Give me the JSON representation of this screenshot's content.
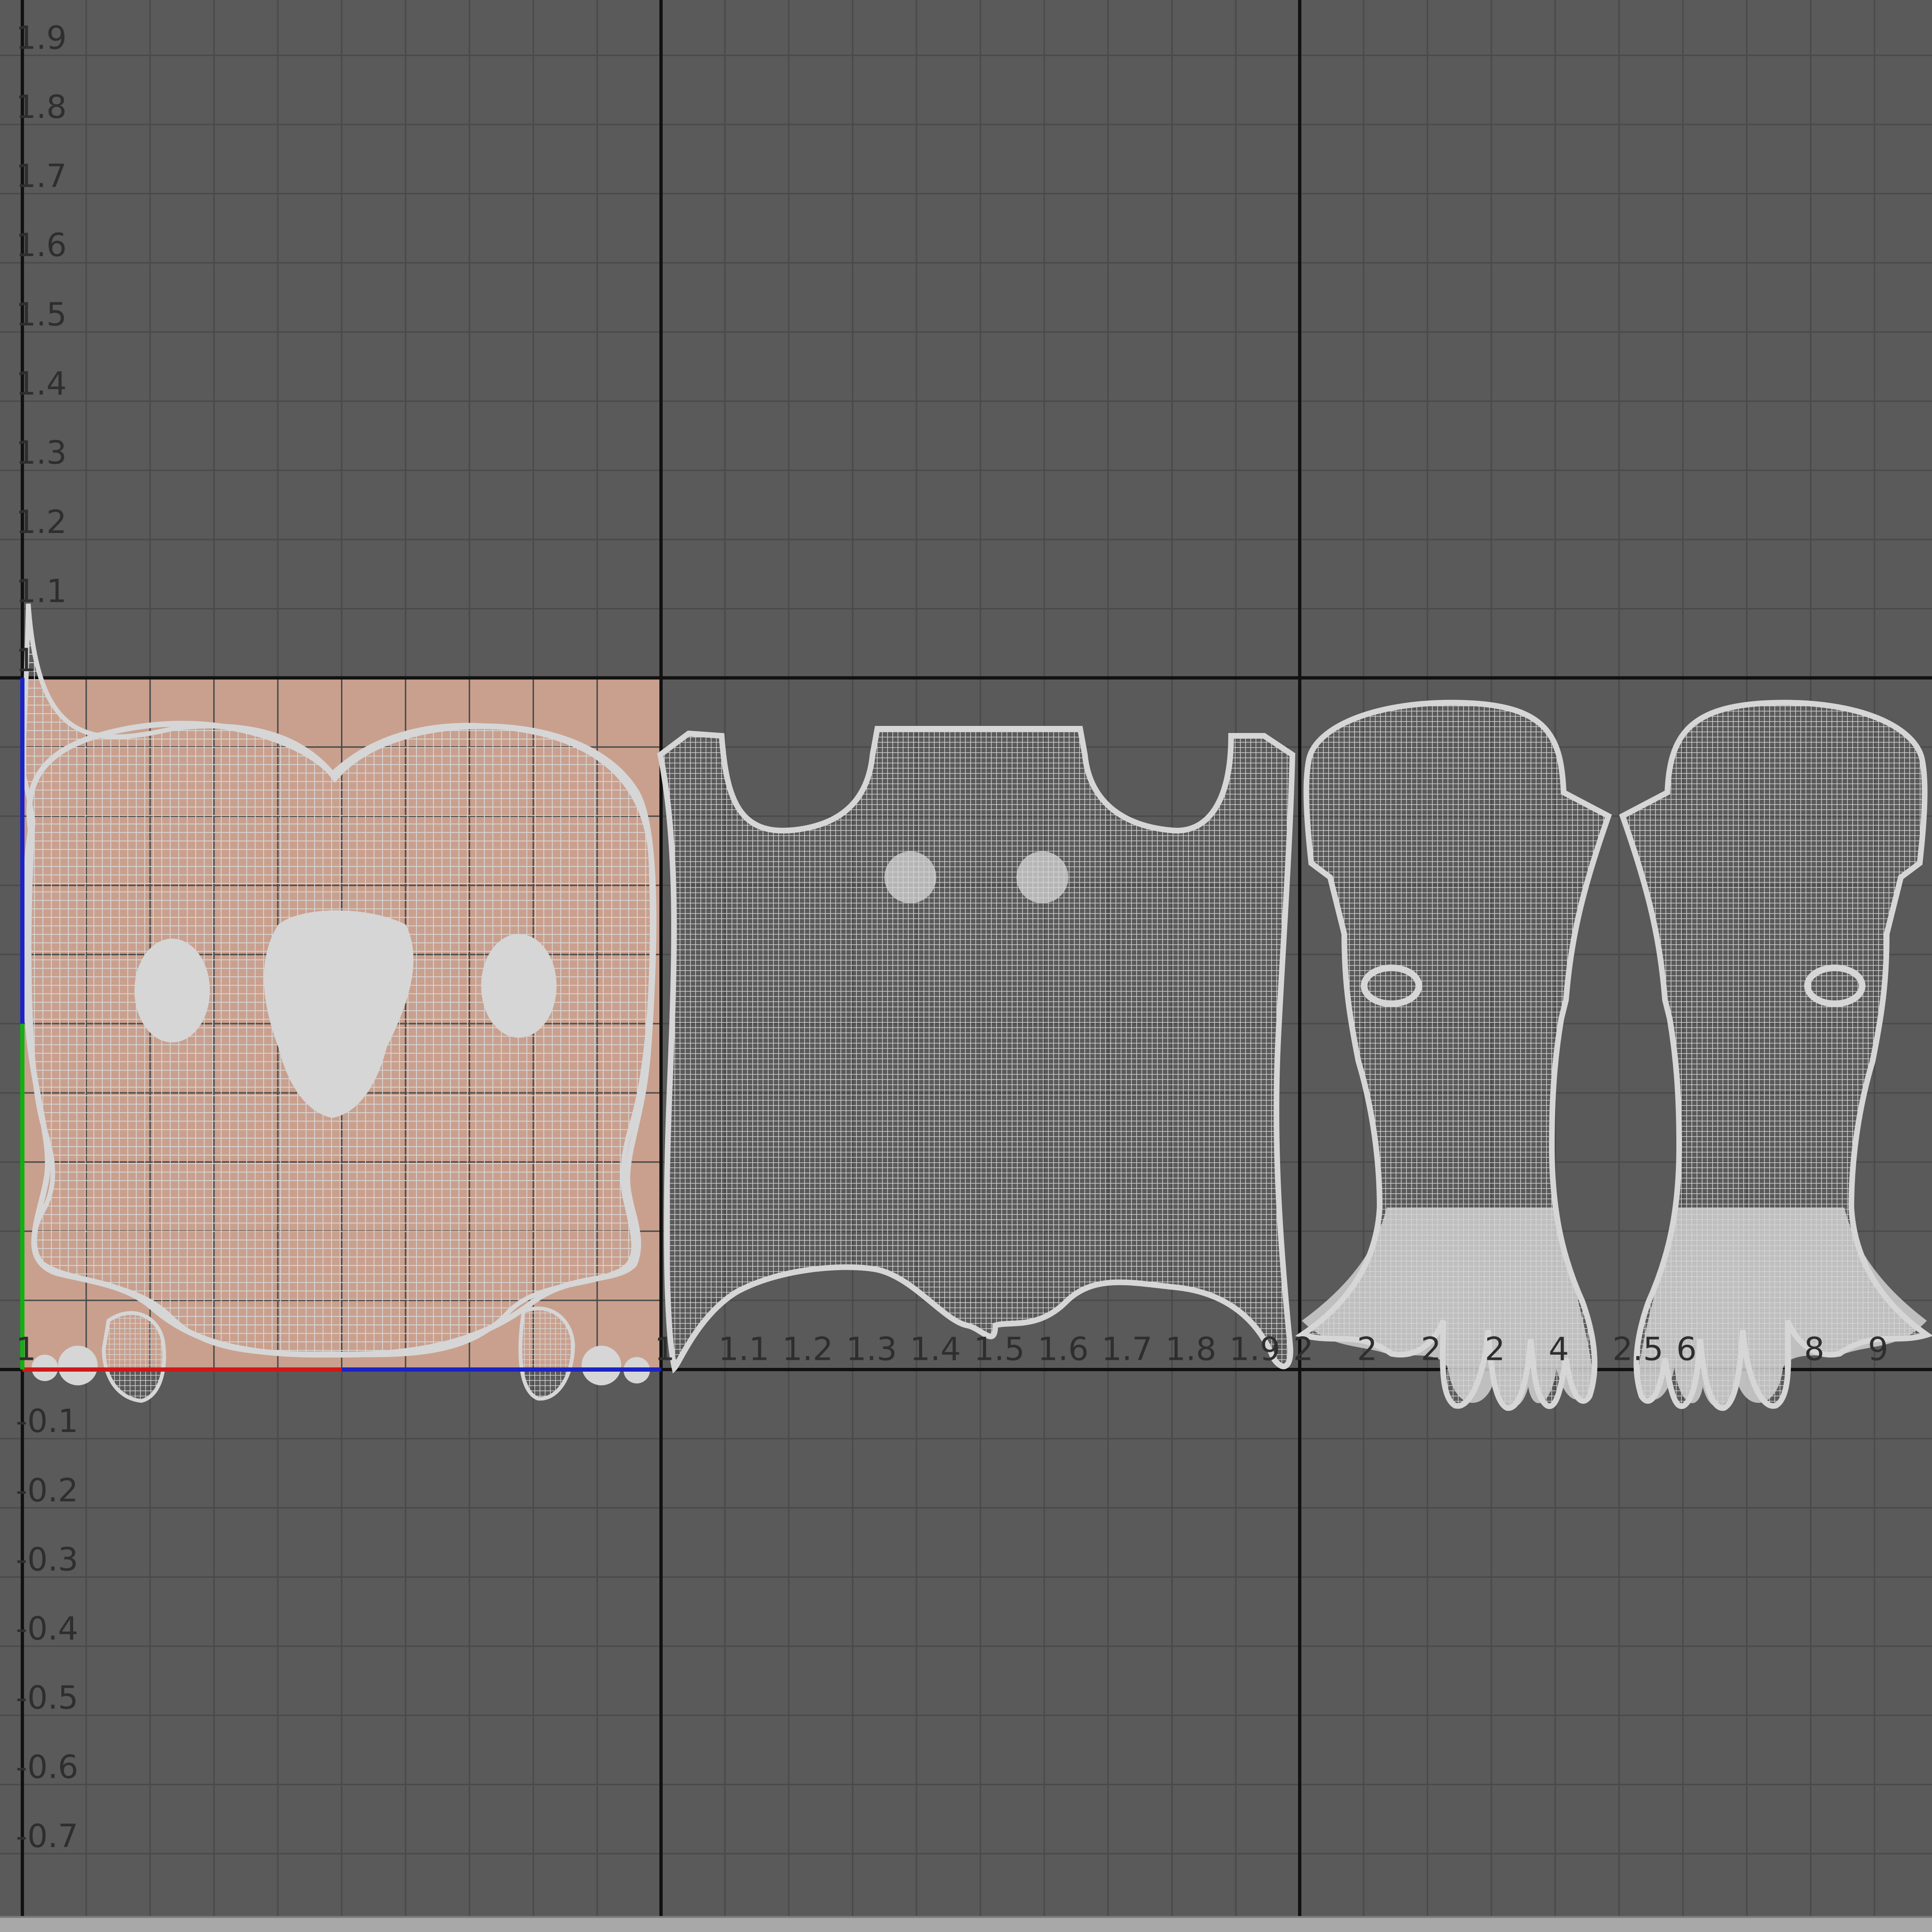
{
  "app": {
    "panel": "UV Texture Editor"
  },
  "colors": {
    "background": "#5a5a5a",
    "grid_minor": "#4a4a4a",
    "grid_major": "#111111",
    "texture_tile": "#c9a08e",
    "uv_wire": "#d6d6d6",
    "u_axis": "#d01818",
    "u_axis_alt": "#1b23c4",
    "v_axis": "#1b23c4",
    "v_axis_alt": "#12b012",
    "label": "#2e2e2e"
  },
  "view": {
    "u_min": -0.035,
    "u_max": 2.99,
    "v_min": -0.79,
    "v_max": 1.98
  },
  "v_labels": [
    {
      "value": 1.9,
      "text": "1.9"
    },
    {
      "value": 1.8,
      "text": "1.8"
    },
    {
      "value": 1.7,
      "text": "1.7"
    },
    {
      "value": 1.6,
      "text": "1.6"
    },
    {
      "value": 1.5,
      "text": "1.5"
    },
    {
      "value": 1.4,
      "text": "1.4"
    },
    {
      "value": 1.3,
      "text": "1.3"
    },
    {
      "value": 1.2,
      "text": "1.2"
    },
    {
      "value": 1.1,
      "text": "1.1"
    },
    {
      "value": 1.0,
      "text": "1"
    },
    {
      "value": -0.1,
      "text": "-0.1"
    },
    {
      "value": -0.2,
      "text": "-0.2"
    },
    {
      "value": -0.3,
      "text": "-0.3"
    },
    {
      "value": -0.4,
      "text": "-0.4"
    },
    {
      "value": -0.5,
      "text": "-0.5"
    },
    {
      "value": -0.6,
      "text": "-0.6"
    },
    {
      "value": -0.7,
      "text": "-0.7"
    }
  ],
  "u_labels": [
    {
      "value": 0.0,
      "text": "1"
    },
    {
      "value": 1.0,
      "text": "1"
    },
    {
      "value": 1.1,
      "text": "1.1"
    },
    {
      "value": 1.2,
      "text": "1.2"
    },
    {
      "value": 1.3,
      "text": "1.3"
    },
    {
      "value": 1.4,
      "text": "1.4"
    },
    {
      "value": 1.5,
      "text": "1.5"
    },
    {
      "value": 1.6,
      "text": "1.6"
    },
    {
      "value": 1.7,
      "text": "1.7"
    },
    {
      "value": 1.8,
      "text": "1.8"
    },
    {
      "value": 1.9,
      "text": "1.9"
    },
    {
      "value": 2.0,
      "text": "2"
    },
    {
      "value": 2.1,
      "text": "2"
    },
    {
      "value": 2.2,
      "text": "2"
    },
    {
      "value": 2.3,
      "text": "2"
    },
    {
      "value": 2.4,
      "text": "4"
    },
    {
      "value": 2.5,
      "text": "2.5"
    },
    {
      "value": 2.6,
      "text": "6"
    },
    {
      "value": 2.8,
      "text": "8"
    },
    {
      "value": 2.9,
      "text": "9"
    }
  ],
  "uv_shells": [
    {
      "name": "head",
      "tile": [
        0,
        0
      ],
      "extent": [
        0.0,
        0.0,
        1.0,
        1.0
      ]
    },
    {
      "name": "torso",
      "tile": [
        1,
        0
      ],
      "extent": [
        1.0,
        0.06,
        2.0,
        0.97
      ]
    },
    {
      "name": "arm-left",
      "tile": [
        2,
        0
      ],
      "extent": [
        2.0,
        0.0,
        2.5,
        1.0
      ]
    },
    {
      "name": "arm-right",
      "tile": [
        2,
        0
      ],
      "extent": [
        2.5,
        0.0,
        3.0,
        1.0
      ]
    }
  ]
}
